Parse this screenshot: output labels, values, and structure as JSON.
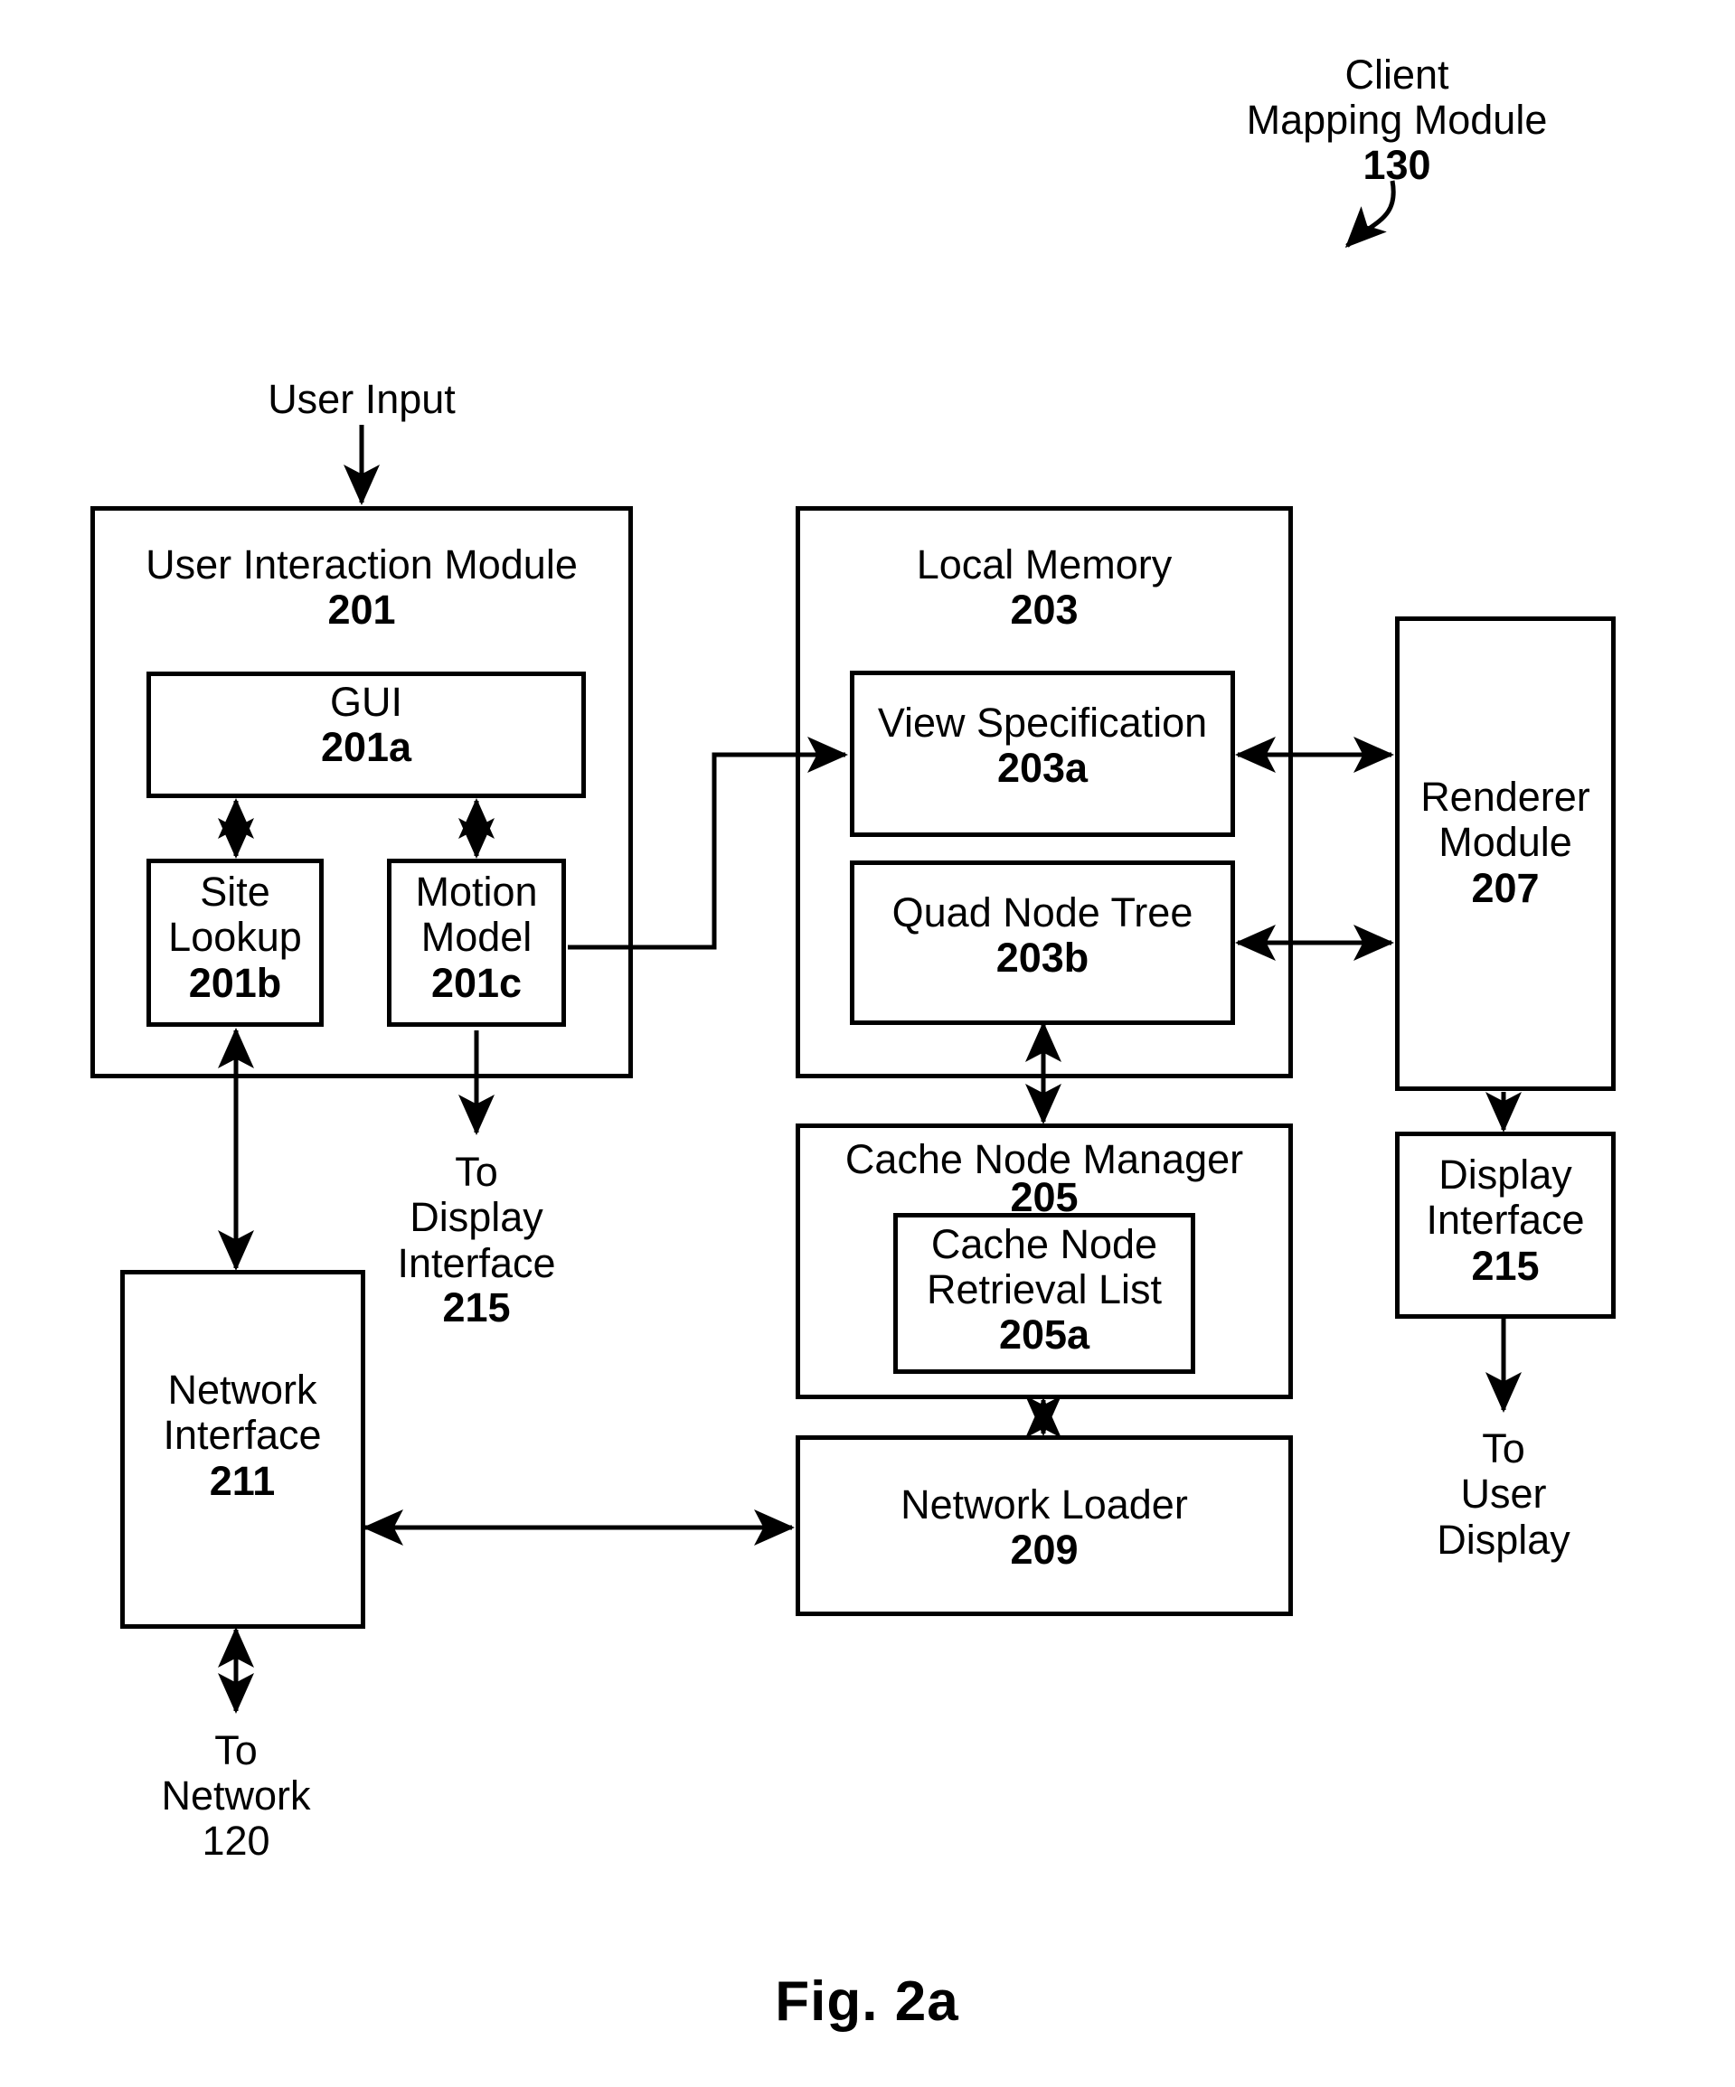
{
  "figure": {
    "caption": "Fig. 2a",
    "callout": {
      "title_line1": "Client",
      "title_line2": "Mapping Module",
      "ref": "130"
    }
  },
  "external_labels": {
    "user_input": "User Input",
    "to_display_interface": "To\nDisplay\nInterface",
    "to_display_interface_ref": "215",
    "to_network": "To\nNetwork",
    "to_network_ref": "120",
    "to_user_display": "To\nUser\nDisplay"
  },
  "blocks": [
    {
      "id": "user-interaction-module",
      "title": "User Interaction Module",
      "ref": "201"
    },
    {
      "id": "gui",
      "title": "GUI",
      "ref": "201a"
    },
    {
      "id": "site-lookup",
      "title": "Site\nLookup",
      "ref": "201b"
    },
    {
      "id": "motion-model",
      "title": "Motion\nModel",
      "ref": "201c"
    },
    {
      "id": "local-memory",
      "title": "Local Memory",
      "ref": "203"
    },
    {
      "id": "view-specification",
      "title": "View Specification",
      "ref": "203a"
    },
    {
      "id": "quad-node-tree",
      "title": "Quad Node Tree",
      "ref": "203b"
    },
    {
      "id": "cache-node-manager",
      "title": "Cache Node Manager",
      "ref": "205"
    },
    {
      "id": "cache-node-retrieval-list",
      "title": "Cache Node\nRetrieval List",
      "ref": "205a"
    },
    {
      "id": "network-loader",
      "title": "Network Loader",
      "ref": "209"
    },
    {
      "id": "renderer-module",
      "title": "Renderer\nModule",
      "ref": "207"
    },
    {
      "id": "display-interface",
      "title": "Display\nInterface",
      "ref": "215"
    },
    {
      "id": "network-interface",
      "title": "Network\nInterface",
      "ref": "211"
    }
  ],
  "colors": {
    "stroke": "#000000",
    "background": "#ffffff"
  }
}
